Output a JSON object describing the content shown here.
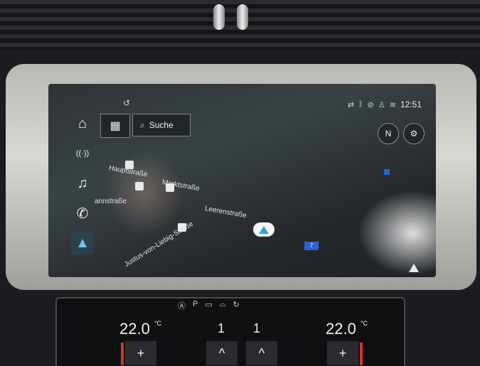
{
  "status": {
    "time": "12:51",
    "icons": [
      "connected-car-icon",
      "bluetooth-icon",
      "mute-icon",
      "passenger-icon",
      "network-icon"
    ]
  },
  "topbar": {
    "icon": "sync-icon"
  },
  "rail": {
    "items": [
      {
        "name": "home",
        "glyph": "⌂"
      },
      {
        "name": "radio",
        "glyph": "((·))"
      },
      {
        "name": "media",
        "glyph": "♫"
      },
      {
        "name": "phone",
        "glyph": "✆"
      },
      {
        "name": "navigation",
        "glyph": "▲"
      }
    ]
  },
  "toolbar": {
    "tiles_glyph": "▦",
    "search_glyph": "⌕",
    "search_label": "Suche"
  },
  "map": {
    "north_label": "N",
    "settings_glyph": "⚙",
    "streets": [
      {
        "label": "Hauptstraße",
        "rot": "10deg"
      },
      {
        "label": "Marktstraße",
        "rot": "10deg"
      },
      {
        "label": "annstraße",
        "rot": "0deg"
      },
      {
        "label": "Leerenstraße",
        "rot": "10deg"
      },
      {
        "label": "Justus-von-Liebig-Straße",
        "rot": "-32deg"
      }
    ],
    "route_badge": "7"
  },
  "climate": {
    "left_temp": "22.0",
    "right_temp": "22.0",
    "left_fan": "1",
    "right_fan": "1",
    "icons": [
      "auto-off-icon",
      "parking-heater-icon",
      "rear-defrost-icon",
      "front-defrost-icon",
      "recirculation-icon"
    ],
    "left_plus": "+",
    "right_plus": "+",
    "up_glyph": "^",
    "unit_left": "°C",
    "unit_right": "°C"
  }
}
